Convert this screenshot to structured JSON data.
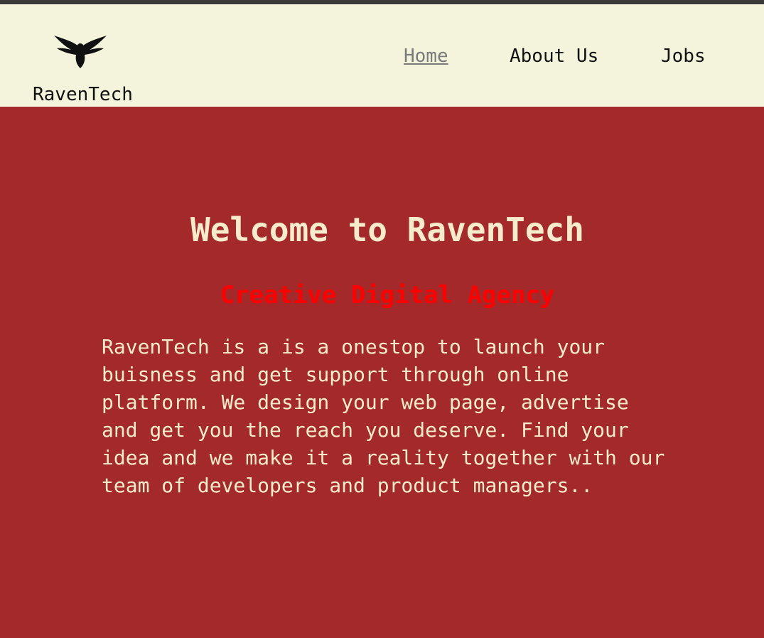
{
  "brand": {
    "name": "RavenTech",
    "logo_icon": "raven-icon"
  },
  "nav": {
    "items": [
      {
        "label": "Home",
        "active": true
      },
      {
        "label": "About Us",
        "active": false
      },
      {
        "label": "Jobs",
        "active": false
      }
    ]
  },
  "hero": {
    "title": "Welcome to RavenTech",
    "subtitle": "Creative Digital Agency",
    "body": "RavenTech is a is a onestop to launch your buisness and get support through online platform. We design your web page, advertise and get you the reach you deserve. Find your idea and we make it a reality together with our team of developers and product managers.."
  },
  "colors": {
    "header_bg": "#f4f4dc",
    "hero_bg": "#a3292b",
    "hero_text": "#f6eccb",
    "subtitle": "#ff0000",
    "nav_active": "#7a7a7a"
  }
}
